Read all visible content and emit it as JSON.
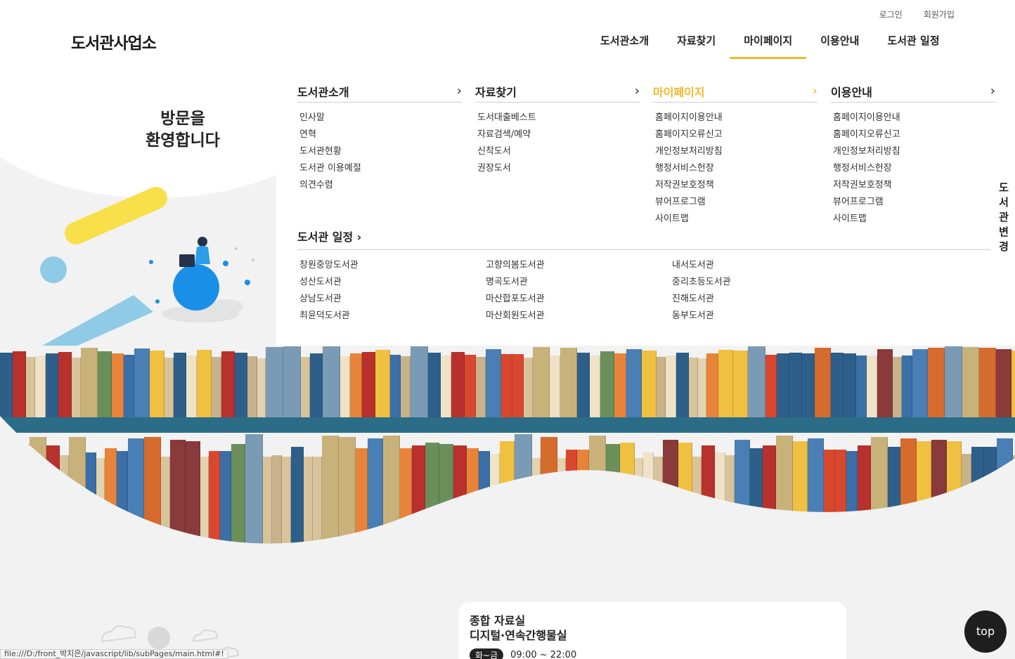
{
  "header": {
    "logo": "도서관사업소",
    "util": [
      "로그인",
      "회원가입"
    ],
    "gnb": [
      "도서관소개",
      "자료찾기",
      "마이페이지",
      "이용안내",
      "도서관 일정"
    ],
    "active_gnb": "마이페이지"
  },
  "welcome": [
    "방문을",
    "환영합니다"
  ],
  "mega_menu": {
    "columns": [
      {
        "title": "도서관소개",
        "items": [
          "인사말",
          "연혁",
          "도서관현황",
          "도서관 이용예절",
          "의견수렴"
        ]
      },
      {
        "title": "자료찾기",
        "items": [
          "도서대출베스트",
          "자료검색/예약",
          "신착도서",
          "권장도서"
        ]
      },
      {
        "title": "마이페이지",
        "items": [
          "홈페이지이용안내",
          "홈페이지오류신고",
          "개인정보처리방침",
          "행정서비스헌장",
          "저작권보호정책",
          "뷰어프로그램",
          "사이트맵"
        ]
      },
      {
        "title": "이용안내",
        "items": [
          "홈페이지이용안내",
          "홈페이지오류신고",
          "개인정보처리방침",
          "행정서비스헌장",
          "저작권보호정책",
          "뷰어프로그램",
          "사이트맵"
        ]
      }
    ],
    "schedule": {
      "title": "도서관 일정",
      "columns": [
        [
          "창원중앙도서관",
          "성산도서관",
          "상남도서관",
          "최윤덕도서관"
        ],
        [
          "고향의봄도서관",
          "명곡도서관",
          "마산합포도서관",
          "마산회원도서관"
        ],
        [
          "내서도서관",
          "중리초등도서관",
          "진해도서관",
          "동부도서관"
        ]
      ]
    }
  },
  "side_tab": "도서관변경",
  "room_card": {
    "line1": "종합 자료실",
    "line2": "디지털·연속간행물실",
    "badge": "화~금",
    "hours": "09:00 ~ 22:00"
  },
  "top_button": "top",
  "status_url": "file:///D:/front_박지은/javascript/lib/subPages/main.html#!",
  "colors": {
    "accent": "#f5b62a",
    "shelf_board": "#2b6d86",
    "top_button": "#1e1e1e"
  }
}
